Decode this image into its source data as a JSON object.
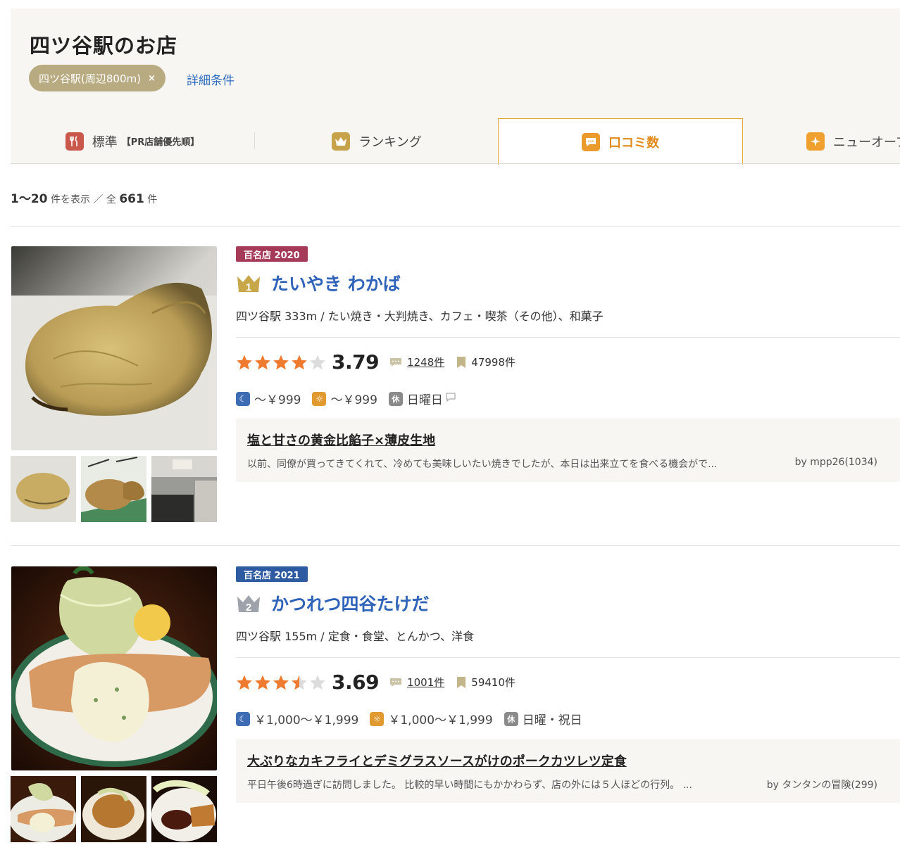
{
  "header": {
    "title": "四ツ谷駅のお店",
    "filter_chip": "四ツ谷駅(周辺800m)",
    "chip_close": "×",
    "detail_link": "詳細条件"
  },
  "tabs": [
    {
      "label": "標準",
      "sub": "【PR店舗優先順】",
      "icon": "fork-knife-icon"
    },
    {
      "label": "ランキング",
      "icon": "crown-icon"
    },
    {
      "label": "口コミ数",
      "icon": "speech-bubble-icon",
      "active": true
    },
    {
      "label": "ニューオープン",
      "icon": "sparkle-icon"
    }
  ],
  "count": {
    "range": "1〜20",
    "range_suffix": "件を表示 ／ 全",
    "total": "661",
    "total_suffix": "件"
  },
  "listings": [
    {
      "badge": "百名店 2020",
      "badge_color": "#a43a57",
      "rank": "1",
      "name": "たいやき わかば",
      "area": "四ツ谷駅 333m / たい焼き・大判焼き、カフェ・喫茶（その他）、和菓子",
      "rating": 3.79,
      "score": "3.79",
      "reviews": "1248件",
      "bookmarks": "47998件",
      "dinner_price": "〜￥999",
      "lunch_price": "〜￥999",
      "holiday_label": "休",
      "holiday": "日曜日",
      "review_title": "塩と甘さの黄金比餡子×薄皮生地",
      "review_snippet": "以前、同僚が買ってきてくれて、冷めても美味しいたい焼きでしたが、本日は出来立てを食べる機会がで...",
      "review_by": "by mpp26(1034)"
    },
    {
      "badge": "百名店 2021",
      "badge_color": "#2d5aa0",
      "rank": "2",
      "name": "かつれつ四谷たけだ",
      "area": "四ツ谷駅 155m / 定食・食堂、とんかつ、洋食",
      "rating": 3.69,
      "score": "3.69",
      "reviews": "1001件",
      "bookmarks": "59410件",
      "dinner_price": "￥1,000〜￥1,999",
      "lunch_price": "￥1,000〜￥1,999",
      "holiday_label": "休",
      "holiday": "日曜・祝日",
      "review_title": "大ぶりなカキフライとデミグラスソースがけのポークカツレツ定食",
      "review_snippet": "平日午後6時過ぎに訪問しました。 比較的早い時間にもかかわらず、店の外には５人ほどの行列。 ...",
      "review_by": "by タンタンの冒険(299)"
    }
  ],
  "colors": {
    "accent_orange": "#e28a1c",
    "link_blue": "#2e63b9",
    "star_orange": "#ee7b30"
  }
}
